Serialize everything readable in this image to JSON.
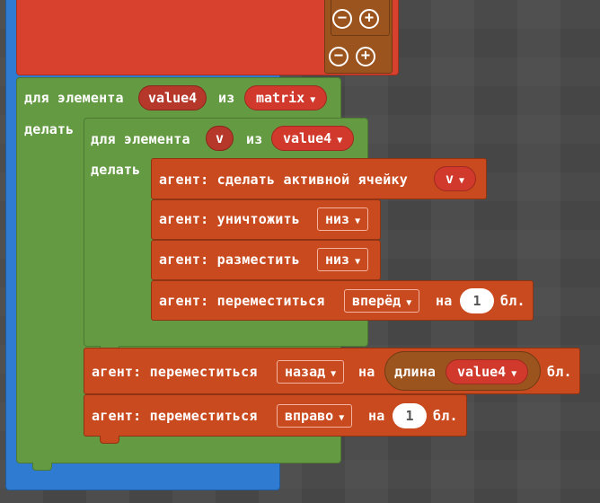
{
  "outer_loop": {
    "for_label": "для элемента",
    "var": "value4",
    "in_label": "из",
    "list": "matrix",
    "do_label": "делать"
  },
  "inner_loop": {
    "for_label": "для элемента",
    "var": "v",
    "in_label": "из",
    "list": "value4",
    "do_label": "делать"
  },
  "inner_statements": [
    {
      "text": "агент: сделать активной ячейку",
      "dropdown": "v"
    },
    {
      "text": "агент: уничтожить",
      "dropdown": "низ"
    },
    {
      "text": "агент: разместить",
      "dropdown": "низ"
    },
    {
      "text": "агент: переместиться",
      "dropdown": "вперёд",
      "on_label": "на",
      "number": "1",
      "unit": "бл."
    }
  ],
  "move_back": {
    "text": "агент: переместиться",
    "dropdown": "назад",
    "on_label": "на",
    "length_label": "длина",
    "length_var": "value4",
    "unit": "бл."
  },
  "move_right": {
    "text": "агент: переместиться",
    "dropdown": "вправо",
    "on_label": "на",
    "number": "1",
    "unit": "бл."
  },
  "mutator_symbols": {
    "minus": "−",
    "plus": "+"
  },
  "dropdown_arrow": "▼",
  "colors": {
    "loops": "#649a42",
    "agent": "#c94a1e",
    "list_block": "#d9412f",
    "function": "#2f7bd1",
    "mutator": "#9c541e"
  }
}
